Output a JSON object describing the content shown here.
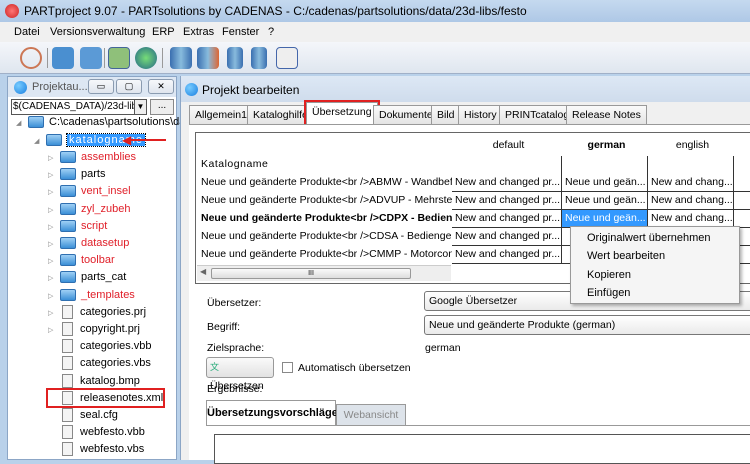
{
  "window": {
    "title": "PARTproject 9.07 - PARTsolutions by CADENAS - C:/cadenas/partsolutions/data/23d-libs/festo"
  },
  "menu": [
    "Datei",
    "Versionsverwaltung",
    "ERP",
    "Extras",
    "Fenster",
    "?"
  ],
  "toolbar": [
    "search-text-icon",
    "save-icon",
    "save-all-icon",
    "image-icon",
    "globe-icon",
    "database-key-icon",
    "database-users-icon",
    "database-icon",
    "database-help-icon",
    "table-icon"
  ],
  "left_panel": {
    "title": "Projektau...",
    "path": "$(CADENAS_DATA)/23d-libs",
    "browse": "...",
    "root": "C:\\cadenas\\partsolutions\\data",
    "selected": "katalogname",
    "items": [
      {
        "label": "assemblies",
        "type": "folder",
        "red": true
      },
      {
        "label": "parts",
        "type": "folder",
        "red": false
      },
      {
        "label": "vent_insel",
        "type": "folder",
        "red": true
      },
      {
        "label": "zyl_zubeh",
        "type": "folder",
        "red": true
      },
      {
        "label": "script",
        "type": "folder",
        "red": true
      },
      {
        "label": "datasetup",
        "type": "folder",
        "red": true
      },
      {
        "label": "toolbar",
        "type": "folder",
        "red": true
      },
      {
        "label": "parts_cat",
        "type": "folder",
        "red": false
      },
      {
        "label": "_templates",
        "type": "folder",
        "red": true
      },
      {
        "label": "categories.prj",
        "type": "file"
      },
      {
        "label": "copyright.prj",
        "type": "file"
      },
      {
        "label": "categories.vbb",
        "type": "file"
      },
      {
        "label": "categories.vbs",
        "type": "file"
      },
      {
        "label": "katalog.bmp",
        "type": "file"
      },
      {
        "label": "releasenotes.xml",
        "type": "file",
        "highlight": true
      },
      {
        "label": "seal.cfg",
        "type": "file"
      },
      {
        "label": "webfesto.vbb",
        "type": "file"
      },
      {
        "label": "webfesto.vbs",
        "type": "file"
      }
    ]
  },
  "right_panel": {
    "title": "Projekt bearbeiten",
    "tabs": [
      "Allgemein1",
      "Kataloghilfe",
      "Übersetzung",
      "Dokumente",
      "Bild",
      "History",
      "PRINTcatalog",
      "Release Notes"
    ],
    "active_tab": "Übersetzung",
    "grid": {
      "columns": [
        "default",
        "german",
        "english"
      ],
      "section": "Katalogname",
      "rows": [
        {
          "name": "Neue und geänderte Produkte<br />ABMW - Wandbefestigu",
          "default": "New and changed pr...",
          "german": "Neue und geän...",
          "english": "New and chang..."
        },
        {
          "name": "Neue und geänderte Produkte<br />ADVUP - Mehrstellungsz",
          "default": "New and changed pr...",
          "german": "Neue und geän...",
          "english": "New and chang..."
        },
        {
          "name": "Neue und geänderte Produkte<br />CDPX - Bedieng",
          "default": "New and changed pr...",
          "german": "Neue und geän...",
          "english": "New and chang..."
        },
        {
          "name": "Neue und geänderte Produkte<br />CDSA - Bediengerät<br",
          "default": "New and changed pr...",
          "german": "",
          "english": ""
        },
        {
          "name": "Neue und geänderte Produkte<br />CMMP - Motorcontroller-",
          "default": "New and changed pr...",
          "german": "",
          "english": ""
        }
      ],
      "scroll_grip": "III"
    },
    "context_menu": [
      "Originalwert übernehmen",
      "Wert bearbeiten",
      "Kopieren",
      "Einfügen"
    ],
    "form": {
      "translator_label": "Übersetzer:",
      "translator_value": "Google Übersetzer",
      "term_label": "Begriff:",
      "term_value": "Neue und geänderte Produkte (german)",
      "target_label": "Zielsprache:",
      "target_value": "german",
      "translate_button": "Übersetzen",
      "auto_translate": "Automatisch übersetzen",
      "auto_checked": false,
      "results_label": "Ergebnisse:",
      "result_tabs": [
        "Übersetzungsvorschläge",
        "Webansicht"
      ]
    }
  },
  "colors": {
    "highlight_red": "#e0202a",
    "selection": "#3399ff"
  }
}
